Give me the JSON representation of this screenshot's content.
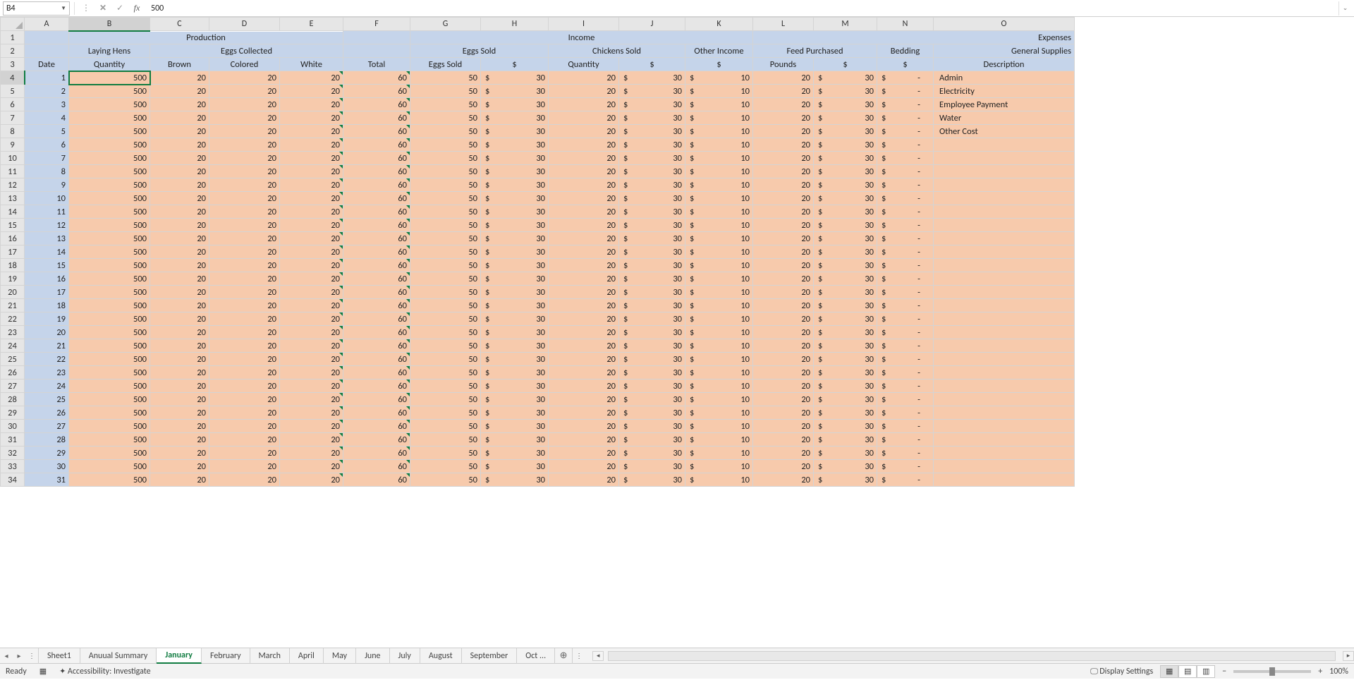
{
  "formula_bar": {
    "cell_ref": "B4",
    "fx_label": "fx",
    "value": "500"
  },
  "columns": [
    "A",
    "B",
    "C",
    "D",
    "E",
    "F",
    "G",
    "H",
    "I",
    "J",
    "K",
    "L",
    "M",
    "N",
    "O"
  ],
  "headers": {
    "row1": {
      "production": "Production",
      "income": "Income",
      "expenses": "Expenses"
    },
    "row2": {
      "laying_hens": "Laying Hens",
      "eggs_collected": "Eggs Collected",
      "eggs_sold": "Eggs Sold",
      "chickens_sold": "Chickens Sold",
      "other_income": "Other Income",
      "feed_purchased": "Feed Purchased",
      "bedding": "Bedding",
      "general_supplies": "General Supplies"
    },
    "row3": {
      "date": "Date",
      "quantity": "Quantity",
      "brown": "Brown",
      "colored": "Colored",
      "white": "White",
      "total": "Total",
      "eggs_sold": "Eggs Sold",
      "dollar": "$",
      "quantity2": "Quantity",
      "pounds": "Pounds",
      "description": "Description"
    }
  },
  "data_template": {
    "quantity": "500",
    "brown": "20",
    "colored": "20",
    "white": "20",
    "total": "60",
    "eggs_sold": "50",
    "eggs_dollar_s": "$",
    "eggs_dollar_v": "30",
    "chick_qty": "20",
    "chick_dollar_s": "$",
    "chick_dollar_v": "30",
    "other_s": "$",
    "other_v": "10",
    "pounds": "20",
    "feed_s": "$",
    "feed_v": "30",
    "bed_s": "$",
    "bed_v": "-"
  },
  "descriptions": [
    "Admin",
    "Electricity",
    "Employee Payment",
    "Water",
    "Other Cost"
  ],
  "num_rows": 31,
  "row_labels": [
    "1",
    "2",
    "3",
    "4",
    "5",
    "6",
    "7",
    "8",
    "9",
    "10",
    "11",
    "12",
    "13",
    "14",
    "15",
    "16",
    "17",
    "18",
    "19",
    "20",
    "21",
    "22",
    "23",
    "24",
    "25",
    "26",
    "27",
    "28",
    "29",
    "30",
    "31",
    "32",
    "33",
    "34"
  ],
  "tabs": {
    "nav_left": "◂",
    "nav_right": "▸",
    "items": [
      "Sheet1",
      "Anuual Summary",
      "January",
      "February",
      "March",
      "April",
      "May",
      "June",
      "July",
      "August",
      "September",
      "Oct ..."
    ],
    "active_index": 2,
    "add": "⊕",
    "more": "⋮"
  },
  "status": {
    "ready": "Ready",
    "accessibility": "Accessibility: Investigate",
    "display": "Display Settings",
    "zoom_minus": "−",
    "zoom_plus": "+",
    "zoom_value": "100%"
  }
}
